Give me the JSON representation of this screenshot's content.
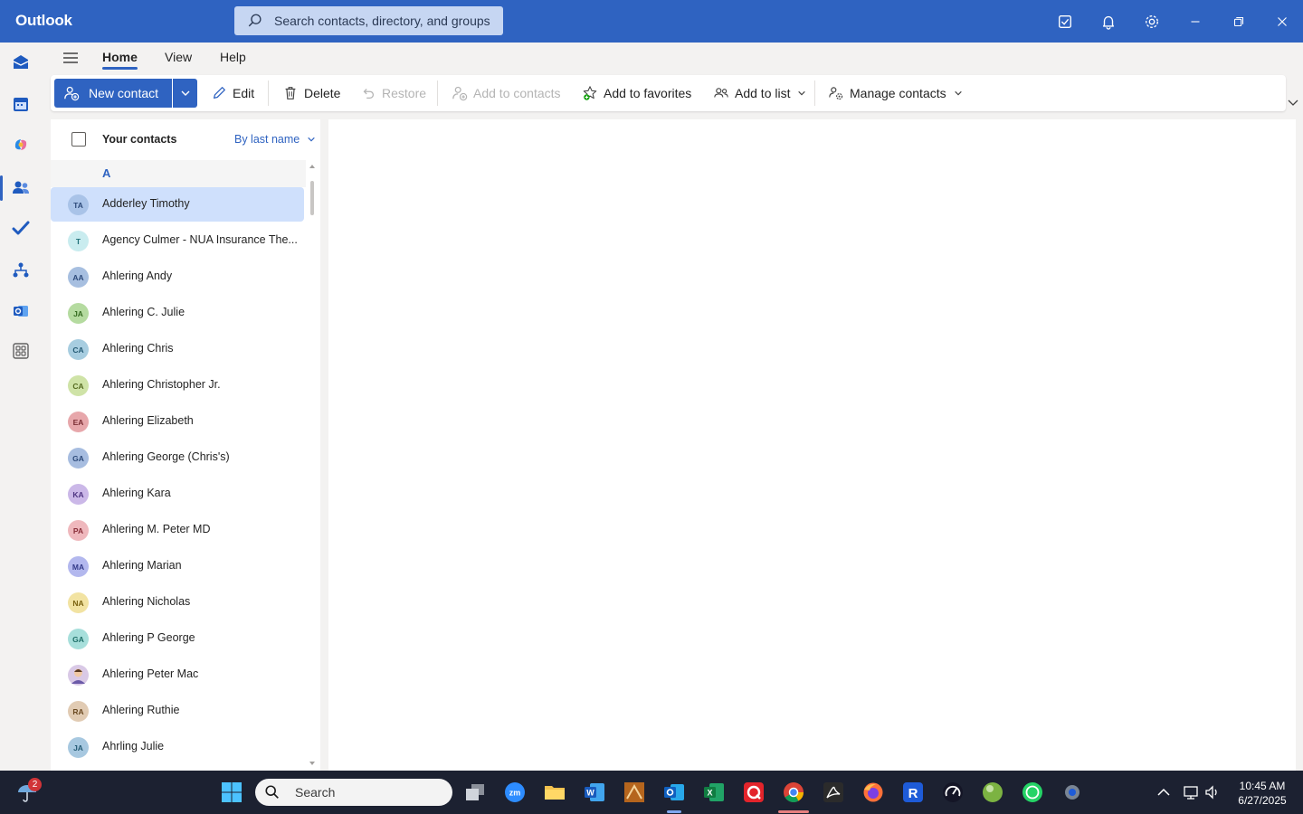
{
  "app": {
    "title": "Outlook"
  },
  "search": {
    "placeholder": "Search contacts, directory, and groups"
  },
  "menu": {
    "tabs": [
      {
        "label": "Home"
      },
      {
        "label": "View"
      },
      {
        "label": "Help"
      }
    ]
  },
  "ribbon": {
    "new_contact": "New contact",
    "edit": "Edit",
    "delete": "Delete",
    "restore": "Restore",
    "add_to_contacts": "Add to contacts",
    "add_to_favorites": "Add to favorites",
    "add_to_list": "Add to list",
    "manage_contacts": "Manage contacts"
  },
  "list": {
    "header": "Your contacts",
    "sort": "By last name",
    "letter": "A",
    "contacts": [
      {
        "initials": "TA",
        "name": "Adderley Timothy",
        "bg": "#a9c3e8",
        "fg": "#2d4a7a"
      },
      {
        "initials": "T",
        "name": "Agency Culmer - NUA Insurance The...",
        "bg": "#c9ecef",
        "fg": "#1f6f78"
      },
      {
        "initials": "AA",
        "name": "Ahlering Andy",
        "bg": "#a7bfe0",
        "fg": "#2d4a7a"
      },
      {
        "initials": "JA",
        "name": "Ahlering C. Julie",
        "bg": "#b5dba0",
        "fg": "#356b21"
      },
      {
        "initials": "CA",
        "name": "Ahlering Chris",
        "bg": "#a7cde0",
        "fg": "#245a74"
      },
      {
        "initials": "CA",
        "name": "Ahlering Christopher Jr.",
        "bg": "#cfe3a7",
        "fg": "#566b21"
      },
      {
        "initials": "EA",
        "name": "Ahlering Elizabeth",
        "bg": "#e7a7ab",
        "fg": "#7a2d33"
      },
      {
        "initials": "GA",
        "name": "Ahlering George (Chris's)",
        "bg": "#a7bde0",
        "fg": "#2d4a7a"
      },
      {
        "initials": "KA",
        "name": "Ahlering Kara",
        "bg": "#cbb8e8",
        "fg": "#4f3582"
      },
      {
        "initials": "PA",
        "name": "Ahlering M. Peter MD",
        "bg": "#efb8bd",
        "fg": "#8a2f3a"
      },
      {
        "initials": "MA",
        "name": "Ahlering Marian",
        "bg": "#b3b8ee",
        "fg": "#343b8a"
      },
      {
        "initials": "NA",
        "name": "Ahlering Nicholas",
        "bg": "#f2e3a2",
        "fg": "#7a6210"
      },
      {
        "initials": "GA",
        "name": "Ahlering P George",
        "bg": "#a7dfdb",
        "fg": "#1f6f68"
      },
      {
        "initials": "",
        "name": "Ahlering Peter Mac",
        "bg": "#d9c9e6",
        "fg": "#4f3582"
      },
      {
        "initials": "RA",
        "name": "Ahlering Ruthie",
        "bg": "#e1cbb3",
        "fg": "#6b4a22"
      },
      {
        "initials": "JA",
        "name": "Ahrling Julie",
        "bg": "#a7c8e0",
        "fg": "#245a74"
      }
    ]
  },
  "taskbar": {
    "search": "Search",
    "badge": "2",
    "time": "10:45 AM",
    "date": "6/27/2025"
  }
}
